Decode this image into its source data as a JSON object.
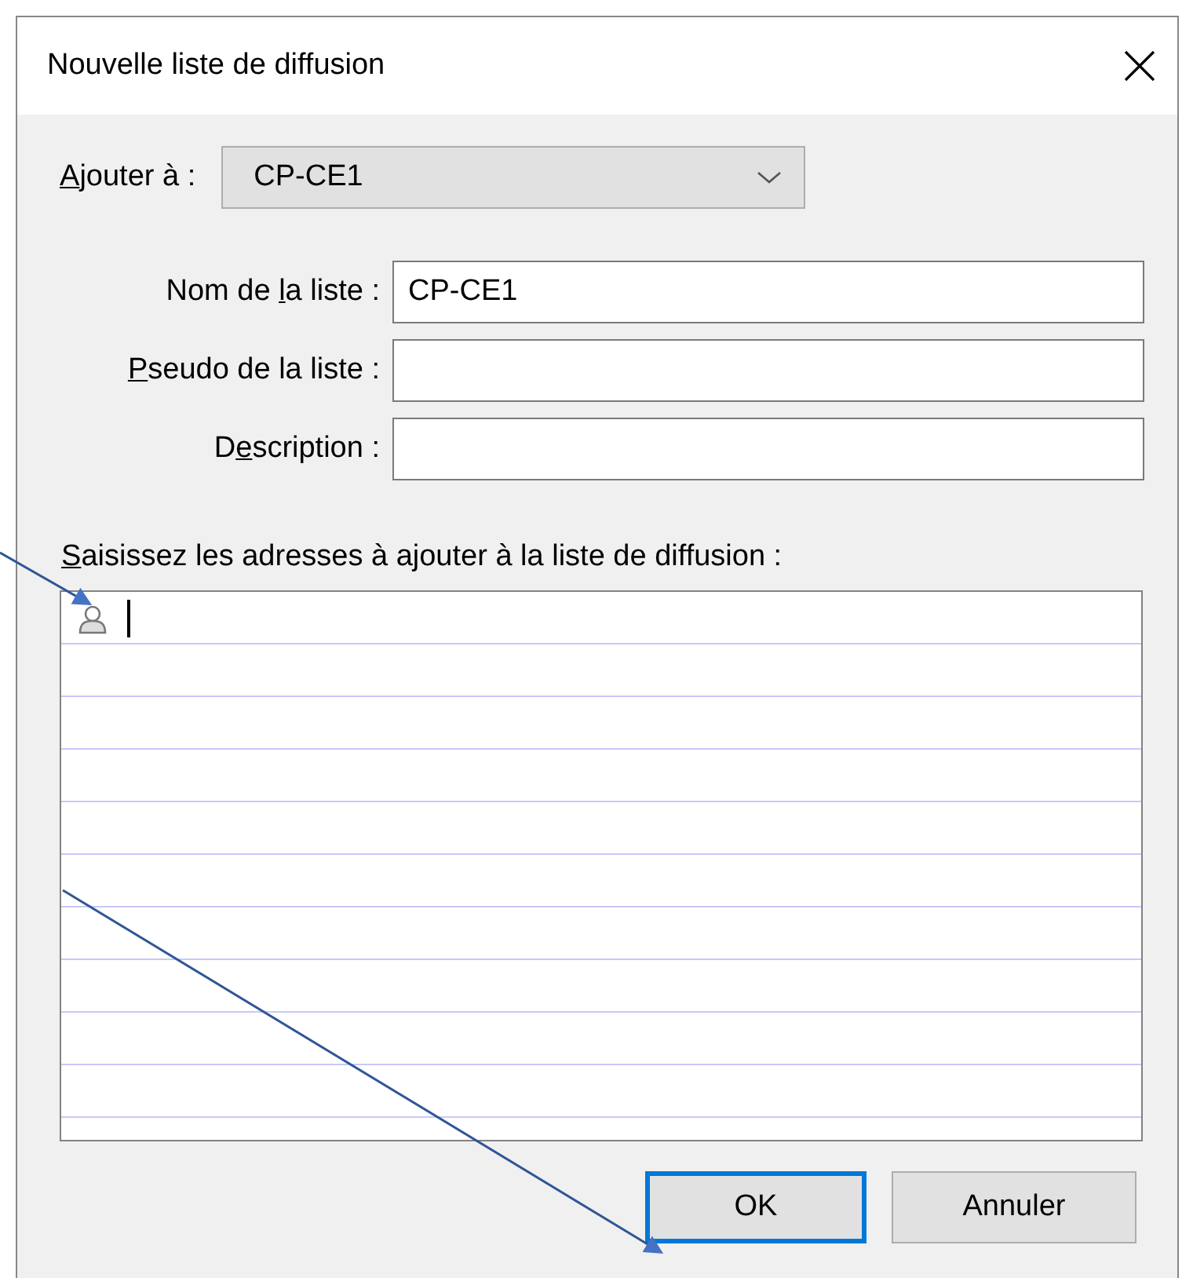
{
  "window": {
    "title": "Nouvelle liste de diffusion"
  },
  "add_to": {
    "label": {
      "key": "A",
      "post": "jouter à :"
    },
    "value": "CP-CE1"
  },
  "fields": [
    {
      "label": {
        "pre": "Nom de ",
        "key": "l",
        "post": "a liste :"
      },
      "value": "CP-CE1"
    },
    {
      "label": {
        "key": "P",
        "post": "seudo de la liste :"
      }
    },
    {
      "label": {
        "pre": "D",
        "key": "e",
        "post": "scription :"
      }
    }
  ],
  "addresses": {
    "label": {
      "key": "S",
      "post": "aisissez les adresses à ajouter à la liste de diffusion :"
    },
    "focused": true
  },
  "buttons": [
    {
      "label": "OK",
      "default": true
    },
    {
      "label": "Annuler",
      "default": false
    }
  ]
}
